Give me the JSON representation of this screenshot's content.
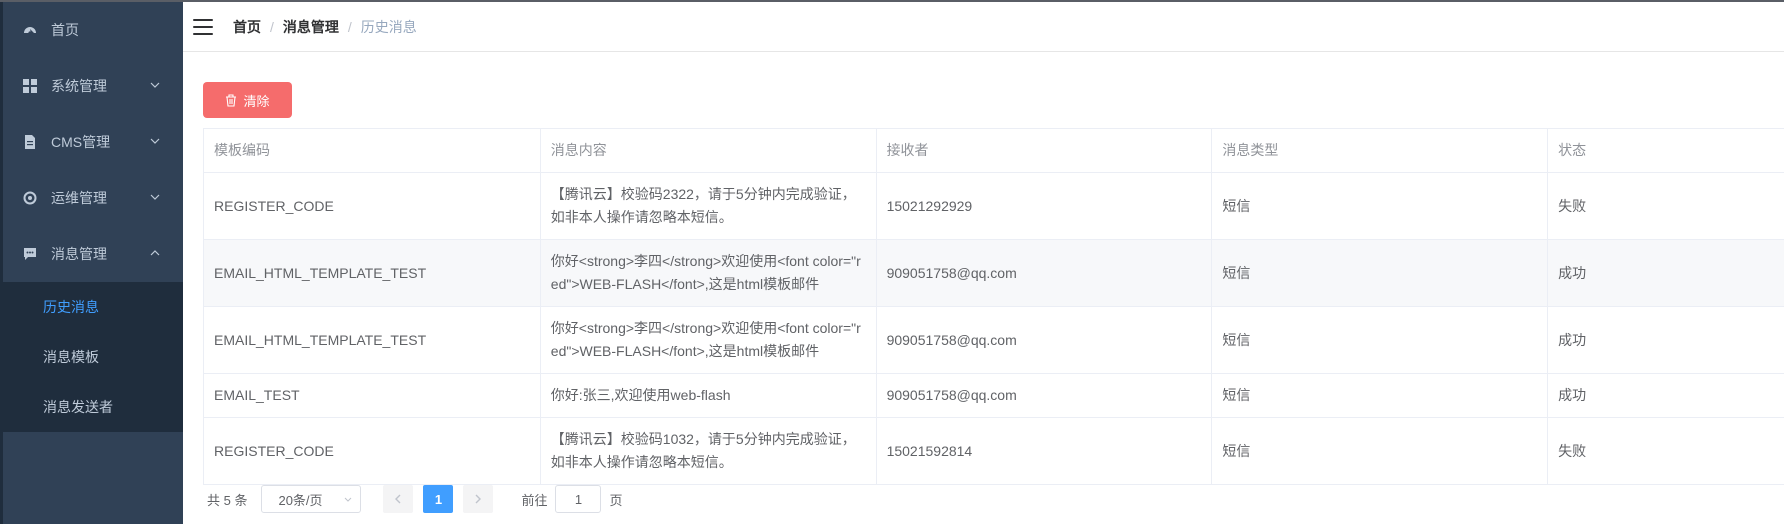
{
  "sidebar": {
    "items": [
      {
        "label": "首页",
        "icon": "dashboard-icon"
      },
      {
        "label": "系统管理",
        "icon": "grid-icon"
      },
      {
        "label": "CMS管理",
        "icon": "document-icon"
      },
      {
        "label": "运维管理",
        "icon": "target-icon"
      },
      {
        "label": "消息管理",
        "icon": "message-icon"
      }
    ],
    "submenu": [
      {
        "label": "历史消息"
      },
      {
        "label": "消息模板"
      },
      {
        "label": "消息发送者"
      }
    ]
  },
  "breadcrumb": {
    "home": "首页",
    "section": "消息管理",
    "current": "历史消息",
    "separator": "/"
  },
  "toolbar": {
    "clear_label": "清除"
  },
  "table": {
    "columns": [
      "模板编码",
      "消息内容",
      "接收者",
      "消息类型",
      "状态"
    ],
    "rows": [
      {
        "code": "REGISTER_CODE",
        "content": "【腾讯云】校验码2322，请于5分钟内完成验证，如非本人操作请忽略本短信。",
        "receiver": "15021292929",
        "type": "短信",
        "status": "失败"
      },
      {
        "code": "EMAIL_HTML_TEMPLATE_TEST",
        "content": "你好<strong>李四</strong>欢迎使用<font color=\"red\">WEB-FLASH</font>,这是html模板邮件",
        "receiver": "909051758@qq.com",
        "type": "短信",
        "status": "成功"
      },
      {
        "code": "EMAIL_HTML_TEMPLATE_TEST",
        "content": "你好<strong>李四</strong>欢迎使用<font color=\"red\">WEB-FLASH</font>,这是html模板邮件",
        "receiver": "909051758@qq.com",
        "type": "短信",
        "status": "成功"
      },
      {
        "code": "EMAIL_TEST",
        "content": "你好:张三,欢迎使用web-flash",
        "receiver": "909051758@qq.com",
        "type": "短信",
        "status": "成功"
      },
      {
        "code": "REGISTER_CODE",
        "content": "【腾讯云】校验码1032，请于5分钟内完成验证，如非本人操作请忽略本短信。",
        "receiver": "15021592814",
        "type": "短信",
        "status": "失败"
      }
    ]
  },
  "pagination": {
    "total": "共 5 条",
    "page_size": "20条/页",
    "current_page": "1",
    "goto_prefix": "前往",
    "goto_value": "1",
    "goto_suffix": "页"
  },
  "colors": {
    "sidebar_bg": "#304156",
    "submenu_bg": "#1f2d3d",
    "active": "#409eff",
    "danger": "#f56c6c"
  }
}
